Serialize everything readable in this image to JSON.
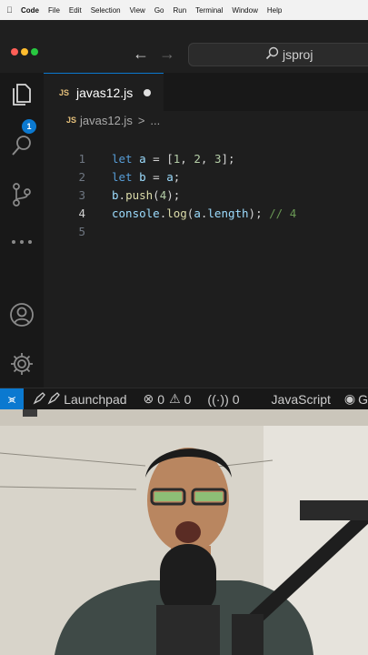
{
  "menubar": {
    "items": [
      "Code",
      "File",
      "Edit",
      "Selection",
      "View",
      "Go",
      "Run",
      "Terminal",
      "Window",
      "Help"
    ]
  },
  "window": {
    "traffic_colors": [
      "#ff5f57",
      "#febc2e",
      "#28c840"
    ]
  },
  "command_center": {
    "text": "jsproj"
  },
  "activity_bar": {
    "explorer_badge": "1"
  },
  "tab": {
    "icon": "JS",
    "name": "javas12.js"
  },
  "breadcrumb": {
    "file": "javas12.js",
    "separator": ">",
    "more": "..."
  },
  "editor": {
    "line_numbers": [
      "1",
      "2",
      "3",
      "4",
      "5"
    ],
    "active_line": "4",
    "lines": [
      [
        {
          "t": "let ",
          "c": "kw"
        },
        {
          "t": "a",
          "c": "var"
        },
        {
          "t": " = [",
          "c": ""
        },
        {
          "t": "1",
          "c": "num"
        },
        {
          "t": ", ",
          "c": ""
        },
        {
          "t": "2",
          "c": "num"
        },
        {
          "t": ", ",
          "c": ""
        },
        {
          "t": "3",
          "c": "num"
        },
        {
          "t": "];",
          "c": ""
        }
      ],
      [
        {
          "t": "let ",
          "c": "kw"
        },
        {
          "t": "b",
          "c": "var"
        },
        {
          "t": " = ",
          "c": ""
        },
        {
          "t": "a",
          "c": "var"
        },
        {
          "t": ";",
          "c": ""
        }
      ],
      [
        {
          "t": "b",
          "c": "var"
        },
        {
          "t": ".",
          "c": ""
        },
        {
          "t": "push",
          "c": "fn"
        },
        {
          "t": "(",
          "c": ""
        },
        {
          "t": "4",
          "c": "num"
        },
        {
          "t": ");",
          "c": ""
        }
      ],
      [
        {
          "t": "console",
          "c": "var"
        },
        {
          "t": ".",
          "c": ""
        },
        {
          "t": "log",
          "c": "fn"
        },
        {
          "t": "(",
          "c": ""
        },
        {
          "t": "a",
          "c": "var"
        },
        {
          "t": ".",
          "c": ""
        },
        {
          "t": "length",
          "c": "var"
        },
        {
          "t": "); ",
          "c": ""
        },
        {
          "t": "// 4",
          "c": "cm"
        }
      ],
      []
    ]
  },
  "status_bar": {
    "launchpad": "Launchpad",
    "errors": "0",
    "warnings": "0",
    "ports": "0",
    "language": "JavaScript",
    "trailing": "G"
  },
  "colors": {
    "accent": "#0b79d0",
    "editor_bg": "#1e1e1e"
  }
}
